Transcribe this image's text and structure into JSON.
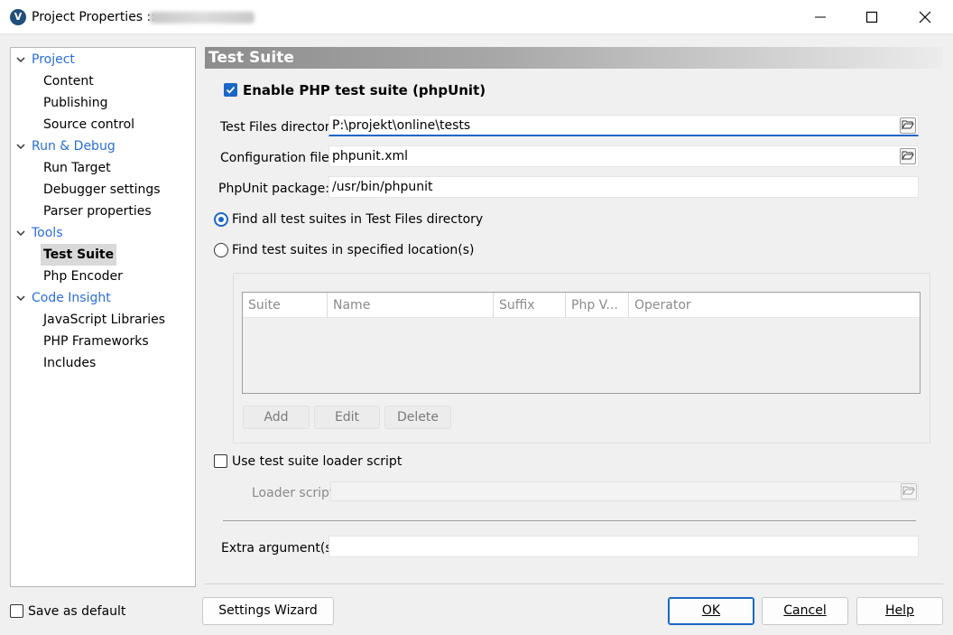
{
  "window": {
    "title": "Project Properties ::",
    "app_icon": "V",
    "controls": {
      "minimize": "minimize-icon",
      "maximize": "maximize-icon",
      "close": "close-icon"
    }
  },
  "sidebar": {
    "categories": [
      {
        "label": "Project",
        "items": [
          "Content",
          "Publishing",
          "Source control"
        ]
      },
      {
        "label": "Run & Debug",
        "items": [
          "Run Target",
          "Debugger settings",
          "Parser properties"
        ]
      },
      {
        "label": "Tools",
        "items": [
          "Test Suite",
          "Php Encoder"
        ]
      },
      {
        "label": "Code Insight",
        "items": [
          "JavaScript Libraries",
          "PHP Frameworks",
          "Includes"
        ]
      }
    ],
    "selected": "Test Suite"
  },
  "main": {
    "section_title": "Test Suite",
    "enable_label": "Enable PHP test suite (phpUnit)",
    "enable_checked": true,
    "test_files_label": "Test Files directory:",
    "test_files_value": "P:\\projekt\\online\\tests",
    "config_label": "Configuration file:",
    "config_value": "phpunit.xml",
    "package_label": "PhpUnit package:",
    "package_value": "/usr/bin/phpunit",
    "radio_find_all": "Find all test suites in Test Files directory",
    "radio_specified": "Find test suites in specified location(s)",
    "selected_radio": "find_all",
    "table_columns": [
      "Suite",
      "Name",
      "Suffix",
      "Php V...",
      "Operator"
    ],
    "table_rows": [],
    "add_label": "Add",
    "edit_label": "Edit",
    "delete_label": "Delete",
    "loader_check_label": "Use test suite loader script",
    "loader_checked": false,
    "loader_script_label": "Loader script:",
    "loader_script_value": "",
    "extra_args_label": "Extra argument(s):",
    "extra_args_value": ""
  },
  "footer": {
    "save_default_label": "Save as default",
    "save_default_checked": false,
    "wizard_label": "Settings Wizard",
    "ok_label": "OK",
    "cancel_label": "Cancel",
    "help_label": "Help"
  },
  "colors": {
    "accent": "#1a66c7",
    "link": "#2a6ed9",
    "header_gradient_start": "#8d8d8d"
  }
}
